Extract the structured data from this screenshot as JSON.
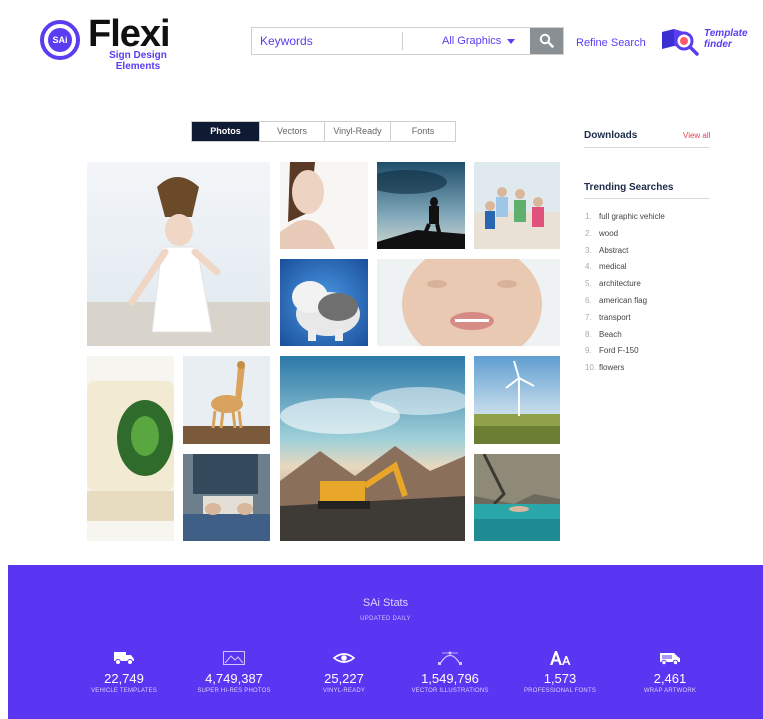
{
  "header": {
    "logo_badge_text": "SAi",
    "logo_name": "Flexi",
    "logo_tagline_1": "Sign Design",
    "logo_tagline_2": "Elements",
    "search_placeholder": "Keywords",
    "search_category": "All Graphics",
    "refine_label": "Refine Search",
    "template_finder_1": "Template",
    "template_finder_2": "finder"
  },
  "tabs": [
    {
      "label": "Photos",
      "active": true
    },
    {
      "label": "Vectors",
      "active": false
    },
    {
      "label": "Vinyl-Ready",
      "active": false
    },
    {
      "label": "Fonts",
      "active": false
    }
  ],
  "sidebar": {
    "downloads_title": "Downloads",
    "view_all": "View all",
    "trending_title": "Trending Searches",
    "trending": [
      {
        "num": "1.",
        "term": "full graphic vehicle"
      },
      {
        "num": "2.",
        "term": "wood"
      },
      {
        "num": "3.",
        "term": "Abstract"
      },
      {
        "num": "4.",
        "term": "medical"
      },
      {
        "num": "5.",
        "term": "architecture"
      },
      {
        "num": "6.",
        "term": "american flag"
      },
      {
        "num": "7.",
        "term": "transport"
      },
      {
        "num": "8.",
        "term": "Beach"
      },
      {
        "num": "9.",
        "term": "Ford F-150"
      },
      {
        "num": "10.",
        "term": "flowers"
      }
    ]
  },
  "stats": {
    "title": "SAi Stats",
    "subtitle": "UPDATED DAILY",
    "items": [
      {
        "icon": "truck-icon",
        "value": "22,749",
        "label": "VEHICLE TEMPLATES"
      },
      {
        "icon": "photo-icon",
        "value": "4,749,387",
        "label": "SUPER HI-RES PHOTOS"
      },
      {
        "icon": "vinyl-eye-icon",
        "value": "25,227",
        "label": "VINYL-READY"
      },
      {
        "icon": "bezier-curve-icon",
        "value": "1,549,796",
        "label": "VECTOR ILLUSTRATIONS"
      },
      {
        "icon": "font-icon",
        "value": "1,573",
        "label": "PROFESSIONAL FONTS"
      },
      {
        "icon": "van-wrap-icon",
        "value": "2,461",
        "label": "WRAP ARTWORK"
      }
    ]
  },
  "colors": {
    "brand_purple": "#5a35f2",
    "tab_active": "#0f1b33",
    "link_red": "#e4444f",
    "search_button": "#8a8f93"
  }
}
